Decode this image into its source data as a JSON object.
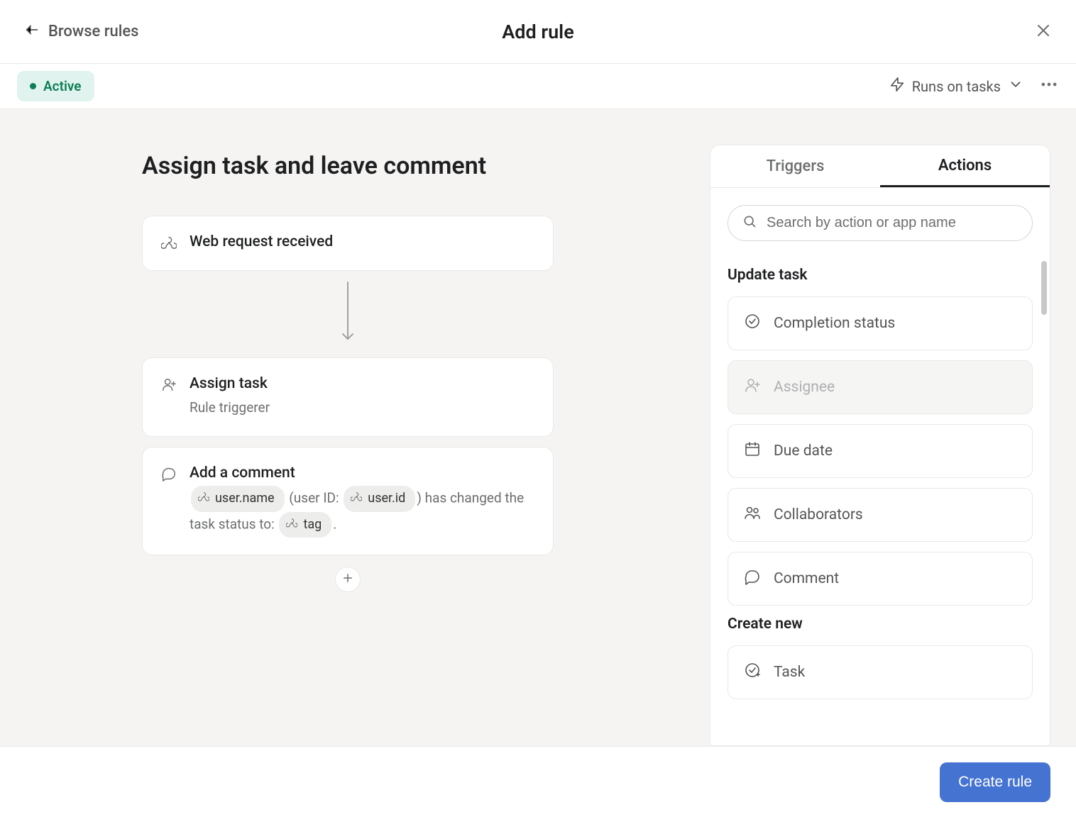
{
  "header": {
    "back_label": "Browse rules",
    "title": "Add rule"
  },
  "subheader": {
    "status_label": "Active",
    "runs_on_label": "Runs on tasks"
  },
  "rule": {
    "name": "Assign task and leave comment",
    "trigger": {
      "title": "Web request received"
    },
    "actions": [
      {
        "title": "Assign task",
        "subtitle": "Rule triggerer"
      },
      {
        "title": "Add a comment",
        "comment_parts": {
          "var1": "user.name",
          "text1": " (user ID: ",
          "var2": "user.id",
          "text2": ") has changed the task status to: ",
          "var3": "tag",
          "text3": "."
        }
      }
    ]
  },
  "side_panel": {
    "tabs": {
      "triggers": "Triggers",
      "actions": "Actions"
    },
    "search_placeholder": "Search by action or app name",
    "sections": [
      {
        "title": "Update task",
        "items": [
          {
            "label": "Completion status",
            "icon": "check-circle",
            "disabled": false
          },
          {
            "label": "Assignee",
            "icon": "person-plus",
            "disabled": true
          },
          {
            "label": "Due date",
            "icon": "calendar",
            "disabled": false
          },
          {
            "label": "Collaborators",
            "icon": "people",
            "disabled": false
          },
          {
            "label": "Comment",
            "icon": "comment",
            "disabled": false
          }
        ]
      },
      {
        "title": "Create new",
        "items": [
          {
            "label": "Task",
            "icon": "task-add",
            "disabled": false
          }
        ]
      }
    ]
  },
  "footer": {
    "create_label": "Create rule"
  }
}
